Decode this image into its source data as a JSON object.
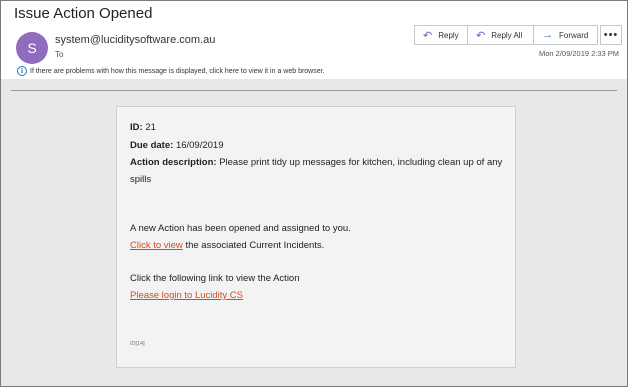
{
  "subject": "Issue Action Opened",
  "sender": {
    "avatar_letter": "S",
    "avatar_color": "#8f6cbd",
    "email": "system@luciditysoftware.com.au",
    "to_label": "To"
  },
  "info_bar": {
    "text": "If there are problems with how this message is displayed, click here to view it in a web browser."
  },
  "actions": {
    "reply": "Reply",
    "reply_all": "Reply All",
    "forward": "Forward",
    "more": "•••"
  },
  "timestamp": "Mon 2/09/2019 2:33 PM",
  "body": {
    "id_label": "ID:",
    "id_value": "21",
    "due_label": "Due date:",
    "due_value": "16/09/2019",
    "desc_label": "Action description:",
    "desc_value_line1": "Please print tidy up messages for kitchen, including clean up of any",
    "desc_value_line2": "spills",
    "opened_text": "A new Action has been opened and assigned to you.",
    "click_view_link": "Click to view",
    "click_view_rest": "the associated Current Incidents.",
    "follow_text": "Click the following link to view the Action",
    "login_link": "Please login to Lucidity CS",
    "ref_id": "ID[14]"
  },
  "colors": {
    "accent": "#6b5bb4",
    "link": "#d54b16",
    "info": "#2e74b5"
  }
}
